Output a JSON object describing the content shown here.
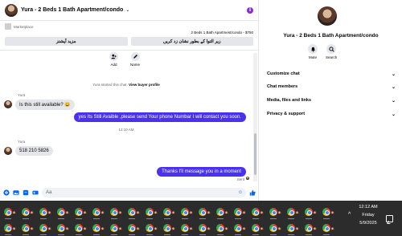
{
  "chat": {
    "title": "Yura - 2 Beds 1 Bath Apartment/condo",
    "listing": {
      "source": "Marketplace",
      "line": "2 Beds 1 Bath Apartment/condo - $750",
      "buttons": [
        "مزید آپشنز",
        "زیر التوا کے بطور نشان زد کریں"
      ]
    },
    "quick_actions": [
      {
        "label": "Add",
        "icon": "person-add-icon"
      },
      {
        "label": "Name",
        "icon": "pencil-icon"
      }
    ],
    "system_note": {
      "text": "Yura started this chat.",
      "link": "View buyer profile"
    },
    "messages": [
      {
        "type": "in",
        "sender": "Yura",
        "text": "Is this still available? 😀"
      },
      {
        "type": "out",
        "text": "yes Its Still Avaible ,please send Your phone Numbar I will contact you soon."
      },
      {
        "type": "time",
        "text": "12:10 AM"
      },
      {
        "type": "in",
        "sender": "Yura",
        "text": "518 210 5826"
      },
      {
        "type": "out",
        "text": "Thanks I'll message you in a moment"
      }
    ],
    "sent_label": "Sent",
    "composer": {
      "placeholder": "Aa"
    }
  },
  "panel": {
    "title": "Yura - 2 Beds 1 Bath Apartment/condo",
    "actions": [
      {
        "label": "Mute",
        "icon": "bell-icon"
      },
      {
        "label": "Search",
        "icon": "search-icon"
      }
    ],
    "sections": [
      "Customize chat",
      "Chat members",
      "Media, files and links",
      "Privacy & support"
    ]
  },
  "taskbar": {
    "time": "12:12 AM",
    "day": "Friday",
    "date": "5/9/2025",
    "tray_up": "^"
  },
  "colors": {
    "accent": "#4a31f2",
    "link_blue": "#0866ff",
    "taskbar": "#2c2c2c"
  }
}
